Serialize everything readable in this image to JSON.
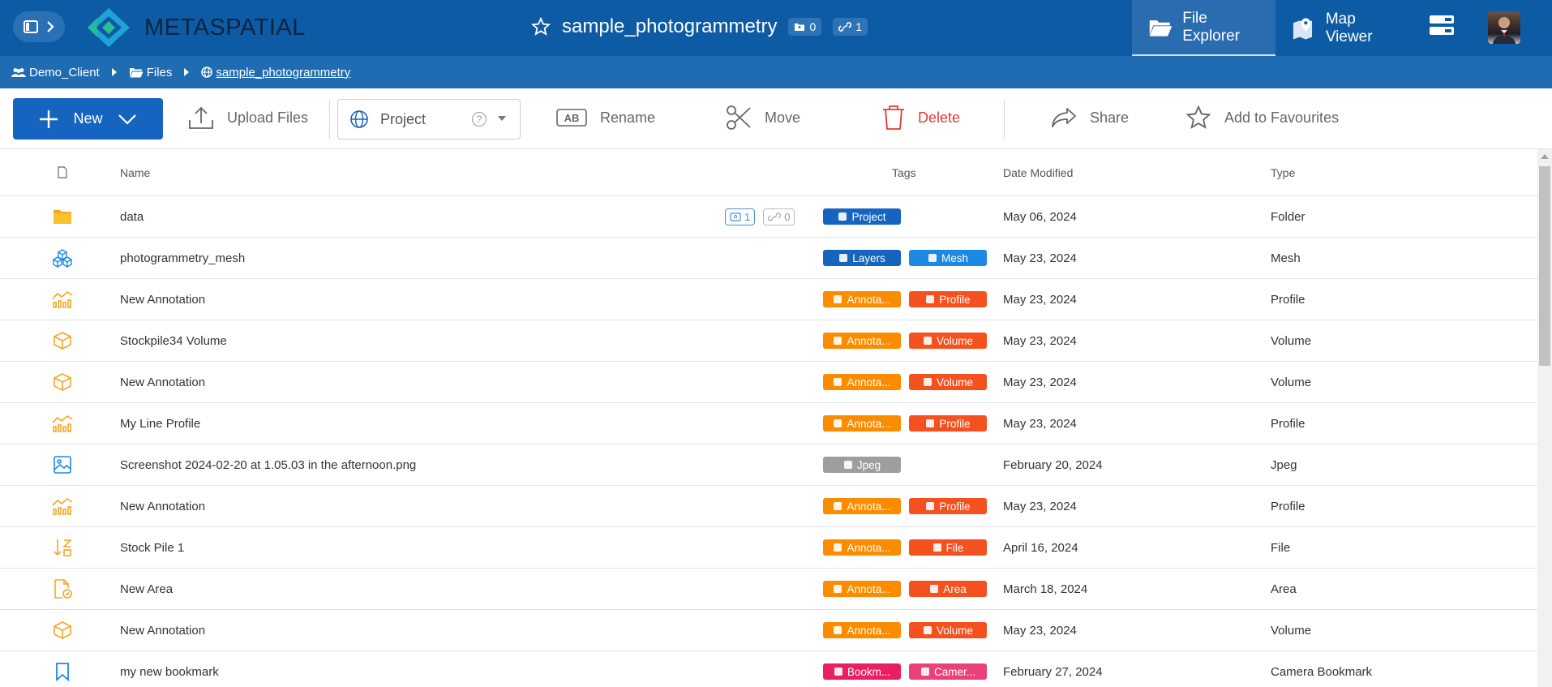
{
  "app": {
    "brand": "METASPATIAL",
    "title": "sample_photogrammetry",
    "badge_files": "0",
    "badge_links": "1"
  },
  "nav": {
    "file_explorer": "File Explorer",
    "map_viewer": "Map Viewer"
  },
  "breadcrumb": {
    "client": "Demo_Client",
    "files": "Files",
    "current": "sample_photogrammetry"
  },
  "toolbar": {
    "new": "New",
    "upload": "Upload Files",
    "project": "Project",
    "rename": "Rename",
    "move": "Move",
    "delete": "Delete",
    "share": "Share",
    "favourites": "Add to Favourites"
  },
  "table": {
    "headers": {
      "name": "Name",
      "tags": "Tags",
      "date": "Date Modified",
      "type": "Type"
    },
    "rows": [
      {
        "icon": "folder-icon",
        "name": "data",
        "tags": [
          {
            "label": "Project",
            "color": "#1565c0"
          }
        ],
        "date": "May 06, 2024",
        "type": "Folder",
        "file_count": "1",
        "link_count": "0"
      },
      {
        "icon": "mesh-icon",
        "name": "photogrammetry_mesh",
        "tags": [
          {
            "label": "Layers",
            "color": "#1565c0"
          },
          {
            "label": "Mesh",
            "color": "#1e88e5"
          }
        ],
        "date": "May 23, 2024",
        "type": "Mesh"
      },
      {
        "icon": "profile-chart-icon",
        "name": "New Annotation",
        "tags": [
          {
            "label": "Annota...",
            "color": "#fb8c00"
          },
          {
            "label": "Profile",
            "color": "#f4511e"
          }
        ],
        "date": "May 23, 2024",
        "type": "Profile"
      },
      {
        "icon": "volume-cube-icon",
        "name": "Stockpile34 Volume",
        "tags": [
          {
            "label": "Annota...",
            "color": "#fb8c00"
          },
          {
            "label": "Volume",
            "color": "#f4511e"
          }
        ],
        "date": "May 23, 2024",
        "type": "Volume"
      },
      {
        "icon": "volume-cube-icon",
        "name": "New Annotation",
        "tags": [
          {
            "label": "Annota...",
            "color": "#fb8c00"
          },
          {
            "label": "Volume",
            "color": "#f4511e"
          }
        ],
        "date": "May 23, 2024",
        "type": "Volume"
      },
      {
        "icon": "profile-chart-icon",
        "name": "My Line Profile",
        "tags": [
          {
            "label": "Annota...",
            "color": "#fb8c00"
          },
          {
            "label": "Profile",
            "color": "#f4511e"
          }
        ],
        "date": "May 23, 2024",
        "type": "Profile"
      },
      {
        "icon": "image-icon",
        "name": "Screenshot 2024-02-20 at 1.05.03 in the afternoon.png",
        "tags": [
          {
            "label": "Jpeg",
            "color": "#9e9e9e"
          }
        ],
        "date": "February 20, 2024",
        "type": "Jpeg"
      },
      {
        "icon": "profile-chart-icon",
        "name": "New Annotation",
        "tags": [
          {
            "label": "Annota...",
            "color": "#fb8c00"
          },
          {
            "label": "Profile",
            "color": "#f4511e"
          }
        ],
        "date": "May 23, 2024",
        "type": "Profile"
      },
      {
        "icon": "file-sort-icon",
        "name": "Stock Pile 1",
        "tags": [
          {
            "label": "Annota...",
            "color": "#fb8c00"
          },
          {
            "label": "File",
            "color": "#f4511e"
          }
        ],
        "date": "April 16, 2024",
        "type": "File"
      },
      {
        "icon": "area-file-icon",
        "name": "New Area",
        "tags": [
          {
            "label": "Annota...",
            "color": "#fb8c00"
          },
          {
            "label": "Area",
            "color": "#f4511e"
          }
        ],
        "date": "March 18, 2024",
        "type": "Area"
      },
      {
        "icon": "volume-cube-icon",
        "name": "New Annotation",
        "tags": [
          {
            "label": "Annota...",
            "color": "#fb8c00"
          },
          {
            "label": "Volume",
            "color": "#f4511e"
          }
        ],
        "date": "May 23, 2024",
        "type": "Volume"
      },
      {
        "icon": "bookmark-icon",
        "name": "my new bookmark",
        "tags": [
          {
            "label": "Bookm...",
            "color": "#e91e63"
          },
          {
            "label": "Camer...",
            "color": "#ec407a"
          }
        ],
        "date": "February 27, 2024",
        "type": "Camera Bookmark"
      }
    ]
  }
}
